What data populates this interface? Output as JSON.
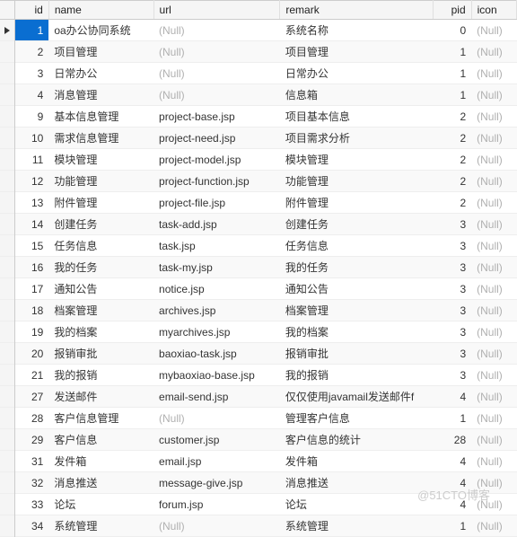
{
  "null_text": "(Null)",
  "columns": {
    "id": "id",
    "name": "name",
    "url": "url",
    "remark": "remark",
    "pid": "pid",
    "icon": "icon"
  },
  "rows": [
    {
      "id": "1",
      "name": "oa办公协同系统",
      "url": null,
      "remark": "系统名称",
      "pid": "0",
      "icon": null,
      "selected": true
    },
    {
      "id": "2",
      "name": "项目管理",
      "url": null,
      "remark": "项目管理",
      "pid": "1",
      "icon": null
    },
    {
      "id": "3",
      "name": "日常办公",
      "url": null,
      "remark": "日常办公",
      "pid": "1",
      "icon": null
    },
    {
      "id": "4",
      "name": "消息管理",
      "url": null,
      "remark": "信息箱",
      "pid": "1",
      "icon": null
    },
    {
      "id": "9",
      "name": "基本信息管理",
      "url": "project-base.jsp",
      "remark": "项目基本信息",
      "pid": "2",
      "icon": null
    },
    {
      "id": "10",
      "name": "需求信息管理",
      "url": "project-need.jsp",
      "remark": "项目需求分析",
      "pid": "2",
      "icon": null
    },
    {
      "id": "11",
      "name": "模块管理",
      "url": "project-model.jsp",
      "remark": "模块管理",
      "pid": "2",
      "icon": null
    },
    {
      "id": "12",
      "name": "功能管理",
      "url": "project-function.jsp",
      "remark": "功能管理",
      "pid": "2",
      "icon": null
    },
    {
      "id": "13",
      "name": "附件管理",
      "url": "project-file.jsp",
      "remark": "附件管理",
      "pid": "2",
      "icon": null
    },
    {
      "id": "14",
      "name": "创建任务",
      "url": "task-add.jsp",
      "remark": "创建任务",
      "pid": "3",
      "icon": null
    },
    {
      "id": "15",
      "name": "任务信息",
      "url": "task.jsp",
      "remark": "任务信息",
      "pid": "3",
      "icon": null
    },
    {
      "id": "16",
      "name": "我的任务",
      "url": "task-my.jsp",
      "remark": "我的任务",
      "pid": "3",
      "icon": null
    },
    {
      "id": "17",
      "name": "通知公告",
      "url": "notice.jsp",
      "remark": "通知公告",
      "pid": "3",
      "icon": null
    },
    {
      "id": "18",
      "name": "档案管理",
      "url": "archives.jsp",
      "remark": "档案管理",
      "pid": "3",
      "icon": null
    },
    {
      "id": "19",
      "name": "我的档案",
      "url": "myarchives.jsp",
      "remark": "我的档案",
      "pid": "3",
      "icon": null
    },
    {
      "id": "20",
      "name": "报销审批",
      "url": "baoxiao-task.jsp",
      "remark": "报销审批",
      "pid": "3",
      "icon": null
    },
    {
      "id": "21",
      "name": "我的报销",
      "url": "mybaoxiao-base.jsp",
      "remark": "我的报销",
      "pid": "3",
      "icon": null
    },
    {
      "id": "27",
      "name": "发送邮件",
      "url": "email-send.jsp",
      "remark": "仅仅使用javamail发送邮件f",
      "pid": "4",
      "icon": null
    },
    {
      "id": "28",
      "name": "客户信息管理",
      "url": null,
      "remark": "管理客户信息",
      "pid": "1",
      "icon": null
    },
    {
      "id": "29",
      "name": "客户信息",
      "url": "customer.jsp",
      "remark": "客户信息的统计",
      "pid": "28",
      "icon": null
    },
    {
      "id": "31",
      "name": "发件箱",
      "url": "email.jsp",
      "remark": "发件箱",
      "pid": "4",
      "icon": null
    },
    {
      "id": "32",
      "name": "消息推送",
      "url": "message-give.jsp",
      "remark": "消息推送",
      "pid": "4",
      "icon": null
    },
    {
      "id": "33",
      "name": "论坛",
      "url": "forum.jsp",
      "remark": "论坛",
      "pid": "4",
      "icon": null
    },
    {
      "id": "34",
      "name": "系统管理",
      "url": null,
      "remark": "系统管理",
      "pid": "1",
      "icon": null
    }
  ],
  "watermark": "@51CTO博客"
}
